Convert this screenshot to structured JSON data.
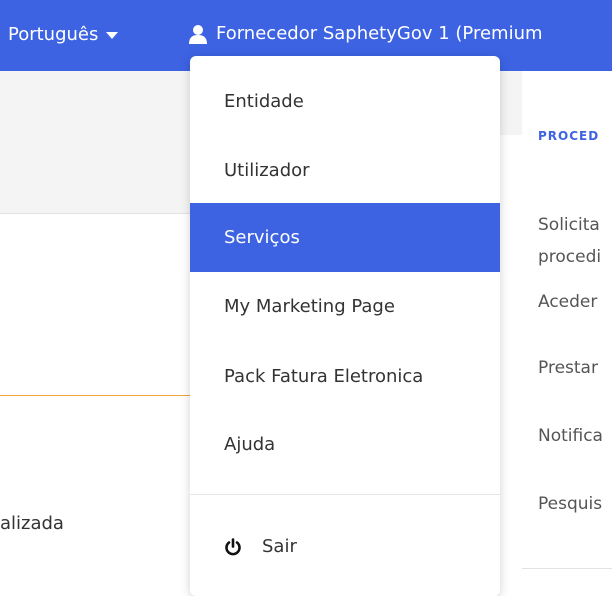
{
  "header": {
    "language": "Português",
    "user": "Fornecedor SaphetyGov 1 (Premium"
  },
  "left": {
    "partial_text": "alizada"
  },
  "right_panel": {
    "title": "PROCED",
    "items": [
      "Solicita",
      "procedi",
      "Aceder",
      "Prestar",
      "Notifica",
      "Pesquis"
    ]
  },
  "menu": {
    "items": [
      "Entidade",
      "Utilizador",
      "Serviços",
      "My Marketing Page",
      "Pack Fatura Eletronica",
      "Ajuda"
    ],
    "active_item": "Serviços",
    "logout": "Sair"
  },
  "colors": {
    "accent": "#3d63e3",
    "orange_line": "#f0a43a"
  },
  "icons": {
    "user": "user-icon",
    "language_caret": "caret-down-icon",
    "logout": "power-icon"
  }
}
